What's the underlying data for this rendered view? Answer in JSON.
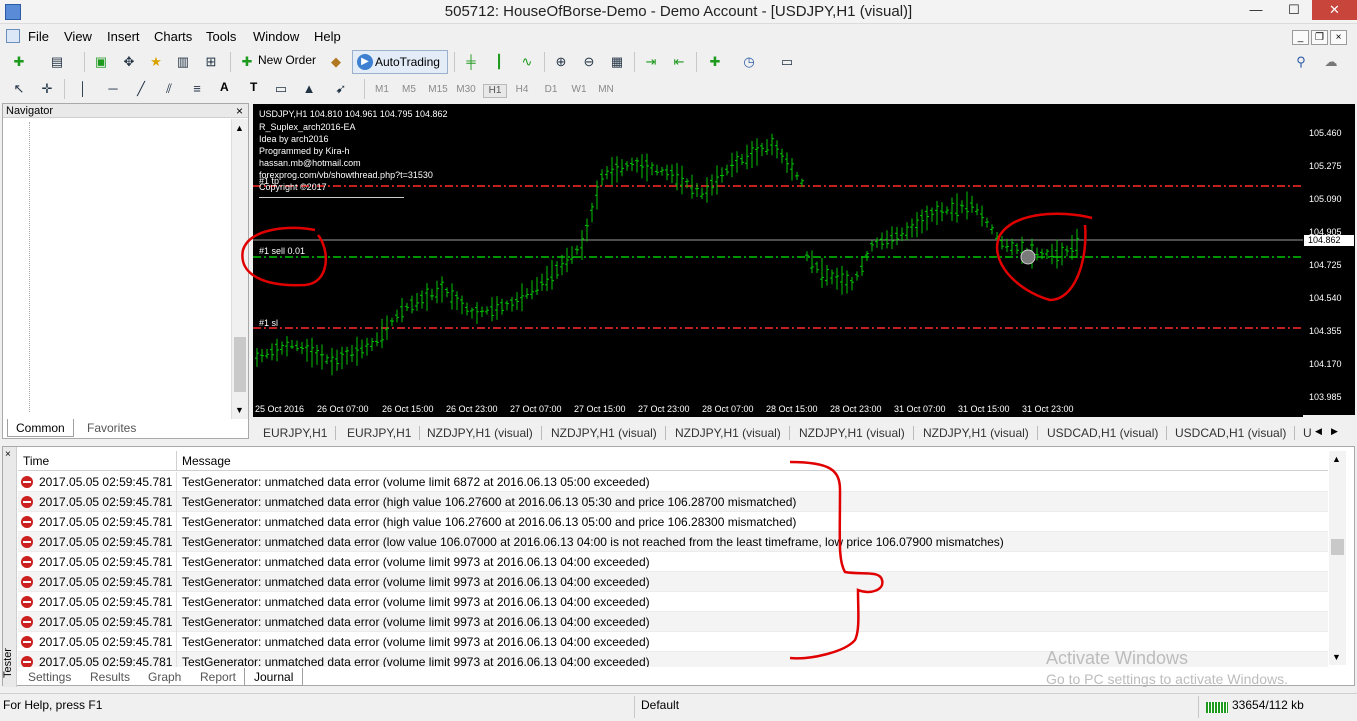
{
  "window": {
    "title": "505712: HouseOfBorse-Demo - Demo Account - [USDJPY,H1 (visual)]",
    "minimize": "—",
    "maximize": "☐",
    "close": "✕"
  },
  "menu": [
    "File",
    "View",
    "Insert",
    "Charts",
    "Tools",
    "Window",
    "Help"
  ],
  "toolbar": {
    "new_order": "New Order",
    "autotrading": "AutoTrading",
    "timeframes": [
      "M1",
      "M5",
      "M15",
      "M30",
      "H1",
      "H4",
      "D1",
      "W1",
      "MN"
    ],
    "selected_timeframe": "H1",
    "draw_labels": [
      "A",
      "T"
    ]
  },
  "navigator": {
    "title": "Navigator",
    "close": "×",
    "tabs": [
      "Common",
      "Favorites"
    ],
    "active_tab": "Common"
  },
  "chart": {
    "symbol_line": "USDJPY,H1  104.810 104.961 104.795 104.862",
    "ea_info": [
      "R_Suplex_arch2016-EA",
      "Idea by arch2016",
      "Programmed by Kira-h",
      "hassan.mb@hotmail.com",
      "forexprog.com/vb/showthread.php?t=31530",
      "Copyright ©2017"
    ],
    "order_labels": {
      "tp": "#1 tp",
      "sell": "#1 sell 0.01",
      "sl": "#1 sl"
    },
    "current_price": "104.862",
    "price_ticks": [
      "105.460",
      "105.275",
      "105.090",
      "104.905",
      "104.725",
      "104.540",
      "104.355",
      "104.170",
      "103.985"
    ],
    "time_ticks": [
      "25 Oct 2016",
      "26 Oct 07:00",
      "26 Oct 15:00",
      "26 Oct 23:00",
      "27 Oct 07:00",
      "27 Oct 15:00",
      "27 Oct 23:00",
      "28 Oct 07:00",
      "28 Oct 15:00",
      "28 Oct 23:00",
      "31 Oct 07:00",
      "31 Oct 15:00",
      "31 Oct 23:00"
    ],
    "colors": {
      "bg": "#000000",
      "bars": "#00c400",
      "tp_sl": "#ff2b2b",
      "entry": "#00c400",
      "grid_line": "#9a9a9a"
    }
  },
  "chart_tabs": [
    "EURJPY,H1",
    "EURJPY,H1",
    "NZDJPY,H1 (visual)",
    "NZDJPY,H1 (visual)",
    "NZDJPY,H1 (visual)",
    "NZDJPY,H1 (visual)",
    "NZDJPY,H1 (visual)",
    "USDCAD,H1 (visual)",
    "USDCAD,H1 (visual)",
    "U"
  ],
  "journal": {
    "columns": {
      "time": "Time",
      "message": "Message"
    },
    "rows": [
      {
        "time": "2017.05.05 02:59:45.781",
        "message": "TestGenerator: unmatched data error (volume limit 6872 at 2016.06.13 05:00 exceeded)"
      },
      {
        "time": "2017.05.05 02:59:45.781",
        "message": "TestGenerator: unmatched data error (high value 106.27600 at 2016.06.13 05:30 and price 106.28700 mismatched)"
      },
      {
        "time": "2017.05.05 02:59:45.781",
        "message": "TestGenerator: unmatched data error (high value 106.27600 at 2016.06.13 05:00 and price 106.28300 mismatched)"
      },
      {
        "time": "2017.05.05 02:59:45.781",
        "message": "TestGenerator: unmatched data error (low value 106.07000 at 2016.06.13 04:00 is not reached from the least timeframe, low price 106.07900 mismatches)"
      },
      {
        "time": "2017.05.05 02:59:45.781",
        "message": "TestGenerator: unmatched data error (volume limit 9973 at 2016.06.13 04:00 exceeded)"
      },
      {
        "time": "2017.05.05 02:59:45.781",
        "message": "TestGenerator: unmatched data error (volume limit 9973 at 2016.06.13 04:00 exceeded)"
      },
      {
        "time": "2017.05.05 02:59:45.781",
        "message": "TestGenerator: unmatched data error (volume limit 9973 at 2016.06.13 04:00 exceeded)"
      },
      {
        "time": "2017.05.05 02:59:45.781",
        "message": "TestGenerator: unmatched data error (volume limit 9973 at 2016.06.13 04:00 exceeded)"
      },
      {
        "time": "2017.05.05 02:59:45.781",
        "message": "TestGenerator: unmatched data error (volume limit 9973 at 2016.06.13 04:00 exceeded)"
      },
      {
        "time": "2017.05.05 02:59:45.781",
        "message": "TestGenerator: unmatched data error (volume limit 9973 at 2016.06.13 04:00 exceeded)"
      }
    ]
  },
  "tester": {
    "side_label": "Tester",
    "tabs": [
      "Settings",
      "Results",
      "Graph",
      "Report",
      "Journal"
    ],
    "active_tab": "Journal"
  },
  "status": {
    "help": "For Help, press F1",
    "profile": "Default",
    "traffic": "33654/112 kb"
  },
  "watermark": {
    "line1": "Activate Windows",
    "line2": "Go to PC settings to activate Windows."
  }
}
